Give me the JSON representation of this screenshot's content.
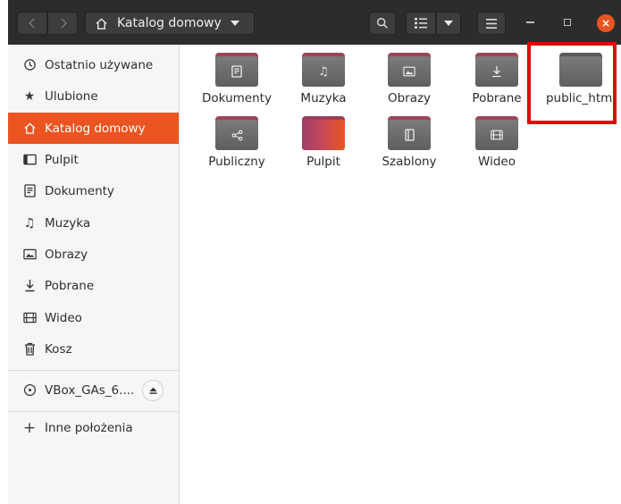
{
  "toolbar": {
    "path_label": "Katalog domowy",
    "back_icon": "chevron-left-icon",
    "forward_icon": "chevron-right-icon",
    "home_icon": "home-icon",
    "search_icon": "search-icon",
    "view_icon": "list-view-icon",
    "menu_icon": "hamburger-icon",
    "close_symbol": "×"
  },
  "sidebar": {
    "items": [
      {
        "label": "Ostatnio używane",
        "icon": "recent-icon"
      },
      {
        "label": "Ulubione",
        "icon": "star-icon"
      },
      {
        "label": "Katalog domowy",
        "icon": "home-icon",
        "active": true
      },
      {
        "label": "Pulpit",
        "icon": "desktop-icon"
      },
      {
        "label": "Dokumenty",
        "icon": "document-icon"
      },
      {
        "label": "Muzyka",
        "icon": "music-icon"
      },
      {
        "label": "Obrazy",
        "icon": "image-icon"
      },
      {
        "label": "Pobrane",
        "icon": "download-icon"
      },
      {
        "label": "Wideo",
        "icon": "video-icon"
      },
      {
        "label": "Kosz",
        "icon": "trash-icon"
      }
    ],
    "device": {
      "label": "VBox_GAs_6....",
      "icon": "disc-icon",
      "eject_icon": "eject-icon"
    },
    "other": {
      "label": "Inne położenia",
      "icon": "plus-icon"
    }
  },
  "files": [
    {
      "name": "Dokumenty",
      "icon": "document-icon"
    },
    {
      "name": "Muzyka",
      "icon": "music-icon"
    },
    {
      "name": "Obrazy",
      "icon": "image-icon"
    },
    {
      "name": "Pobrane",
      "icon": "download-icon"
    },
    {
      "name": "public_html",
      "icon": "folder-icon"
    },
    {
      "name": "Publiczny",
      "icon": "share-icon"
    },
    {
      "name": "Pulpit",
      "icon": "desktop-folder-icon"
    },
    {
      "name": "Szablony",
      "icon": "template-icon"
    },
    {
      "name": "Wideo",
      "icon": "video-icon"
    }
  ],
  "colors": {
    "accent": "#e95420",
    "headerbar": "#2c2c2c",
    "highlight_box": "#e60000"
  }
}
